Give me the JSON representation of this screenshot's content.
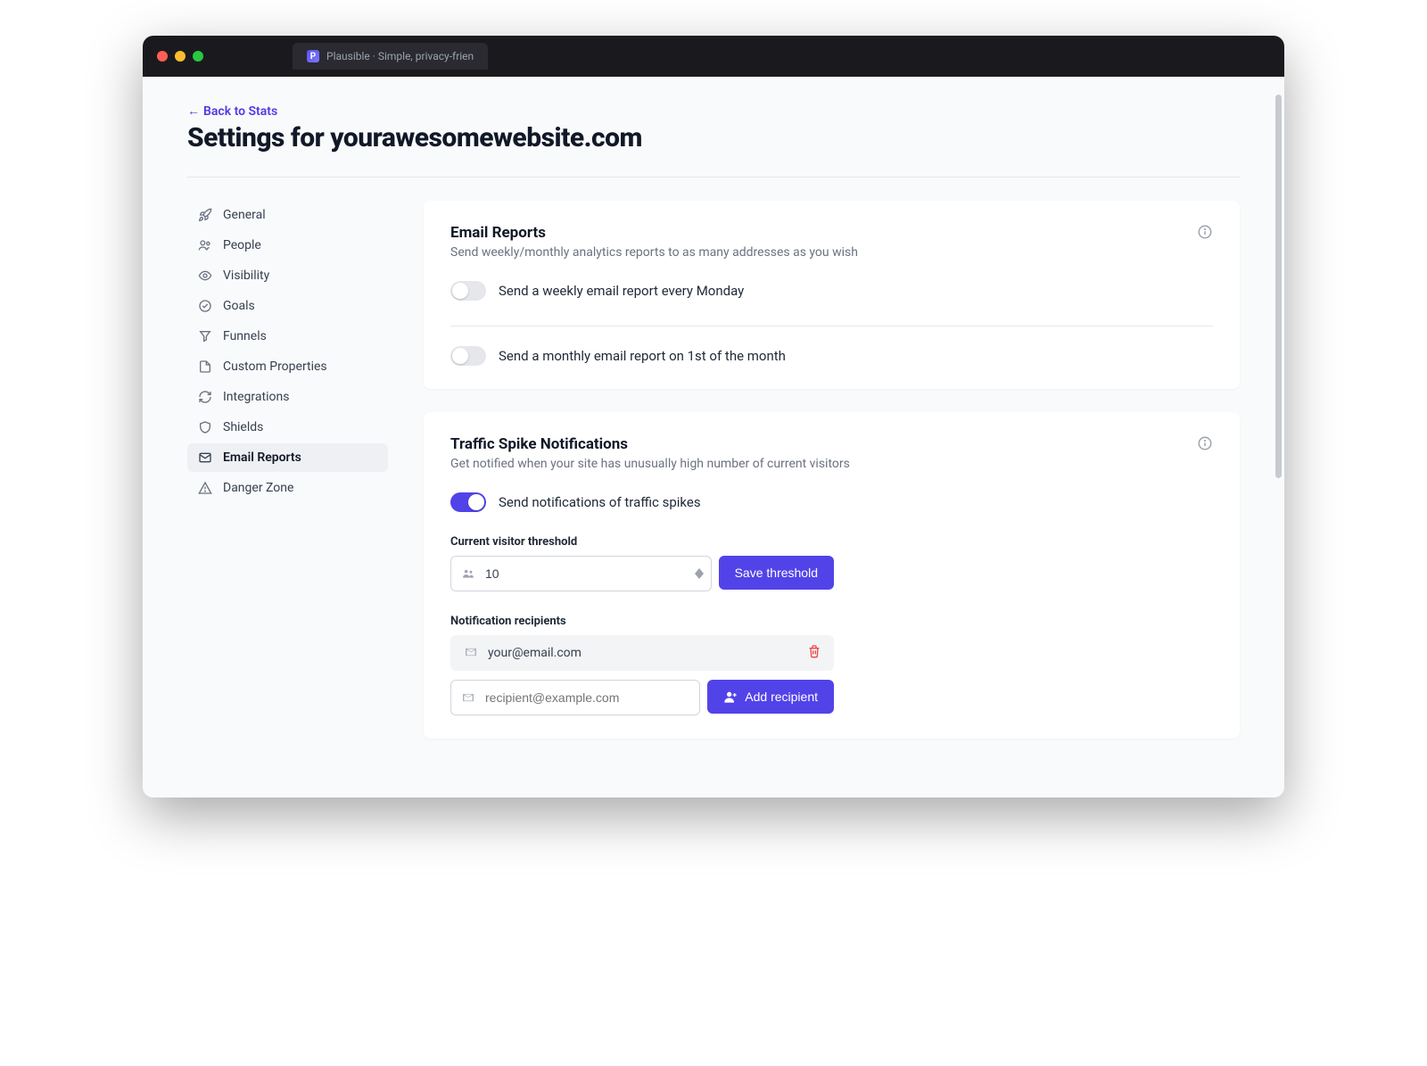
{
  "window": {
    "tab_title": "Plausible · Simple, privacy-frien"
  },
  "header": {
    "back_label": "Back to Stats",
    "page_title": "Settings for yourawesomewebsite.com"
  },
  "sidebar": {
    "items": [
      {
        "label": "General"
      },
      {
        "label": "People"
      },
      {
        "label": "Visibility"
      },
      {
        "label": "Goals"
      },
      {
        "label": "Funnels"
      },
      {
        "label": "Custom Properties"
      },
      {
        "label": "Integrations"
      },
      {
        "label": "Shields"
      },
      {
        "label": "Email Reports"
      },
      {
        "label": "Danger Zone"
      }
    ],
    "active_index": 8
  },
  "email_reports": {
    "title": "Email Reports",
    "subtitle": "Send weekly/monthly analytics reports to as many addresses as you wish",
    "weekly": {
      "on": false,
      "label": "Send a weekly email report every Monday"
    },
    "monthly": {
      "on": false,
      "label": "Send a monthly email report on 1st of the month"
    }
  },
  "traffic_spike": {
    "title": "Traffic Spike Notifications",
    "subtitle": "Get notified when your site has unusually high number of current visitors",
    "toggle": {
      "on": true,
      "label": "Send notifications of traffic spikes"
    },
    "threshold_label": "Current visitor threshold",
    "threshold_value": "10",
    "save_label": "Save threshold",
    "recipients_label": "Notification recipients",
    "recipients": [
      {
        "email": "your@email.com"
      }
    ],
    "add_placeholder": "recipient@example.com",
    "add_label": "Add recipient"
  }
}
